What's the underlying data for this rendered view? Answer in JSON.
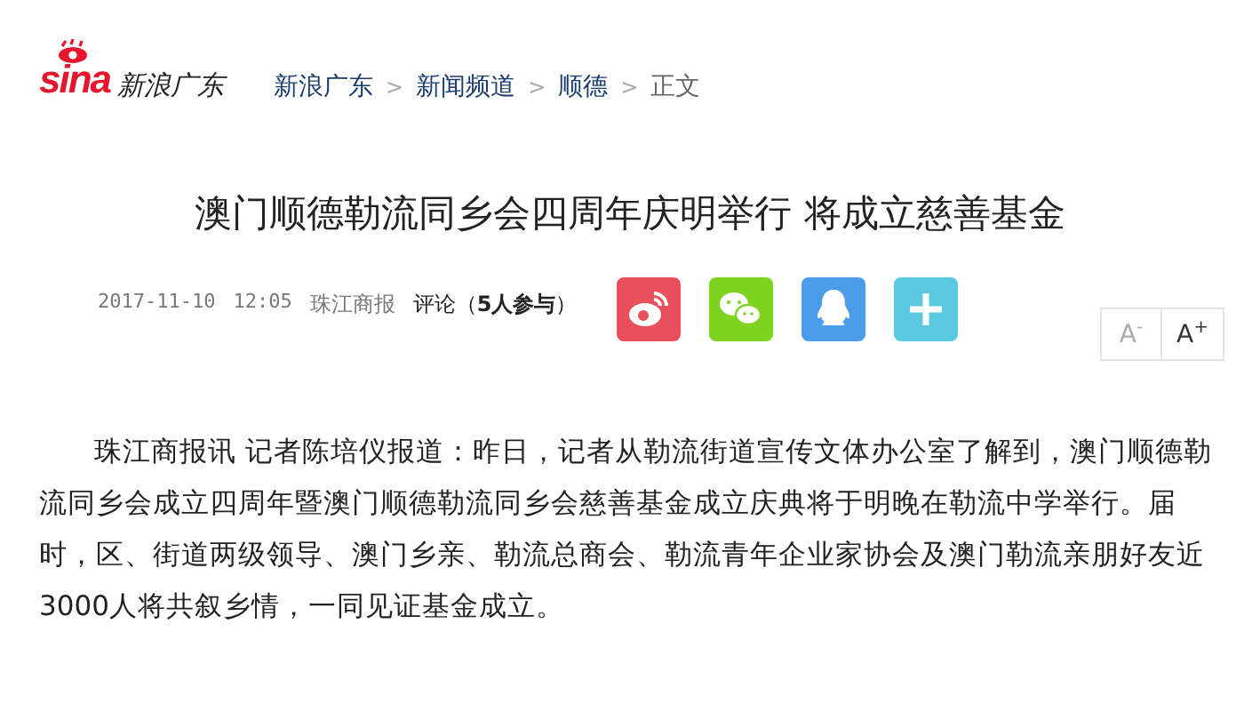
{
  "header": {
    "logo_text": "sina",
    "site_name": "新浪广东"
  },
  "breadcrumb": [
    {
      "label": "新浪广东",
      "kind": "link"
    },
    {
      "label": "新闻频道",
      "kind": "link"
    },
    {
      "label": "顺德",
      "kind": "link"
    },
    {
      "label": "正文",
      "kind": "current"
    }
  ],
  "separator": ">",
  "article": {
    "title": "澳门顺德勒流同乡会四周年庆明举行 将成立慈善基金",
    "date": "2017-11-10",
    "time": "12:05",
    "source": "珠江商报",
    "comments": "评论（**5人参与**）",
    "share": [
      {
        "kind": "weibo",
        "color": "#e8505b"
      },
      {
        "kind": "wechat",
        "color": "#7ed321"
      },
      {
        "kind": "qq",
        "color": "#4a9de8"
      },
      {
        "kind": "more",
        "color": "#5bc8e0"
      }
    ],
    "font_buttons": [
      {
        "label": "A",
        "sup": "-"
      },
      {
        "label": "A",
        "sup": "+"
      }
    ],
    "body": "珠江商报讯 记者陈培仪报道：昨日，记者从勒流街道宣传文体办公室了解到，澳门顺德勒流同乡会成立四周年暨澳门顺德勒流同乡会慈善基金成立庆典将于明晚在勒流中学举行。届时，区、街道两级领导、澳门乡亲、勒流总商会、勒流青年企业家协会及澳门勒流亲朋好友近3000人将共叙乡情，一同见证基金成立。"
  }
}
